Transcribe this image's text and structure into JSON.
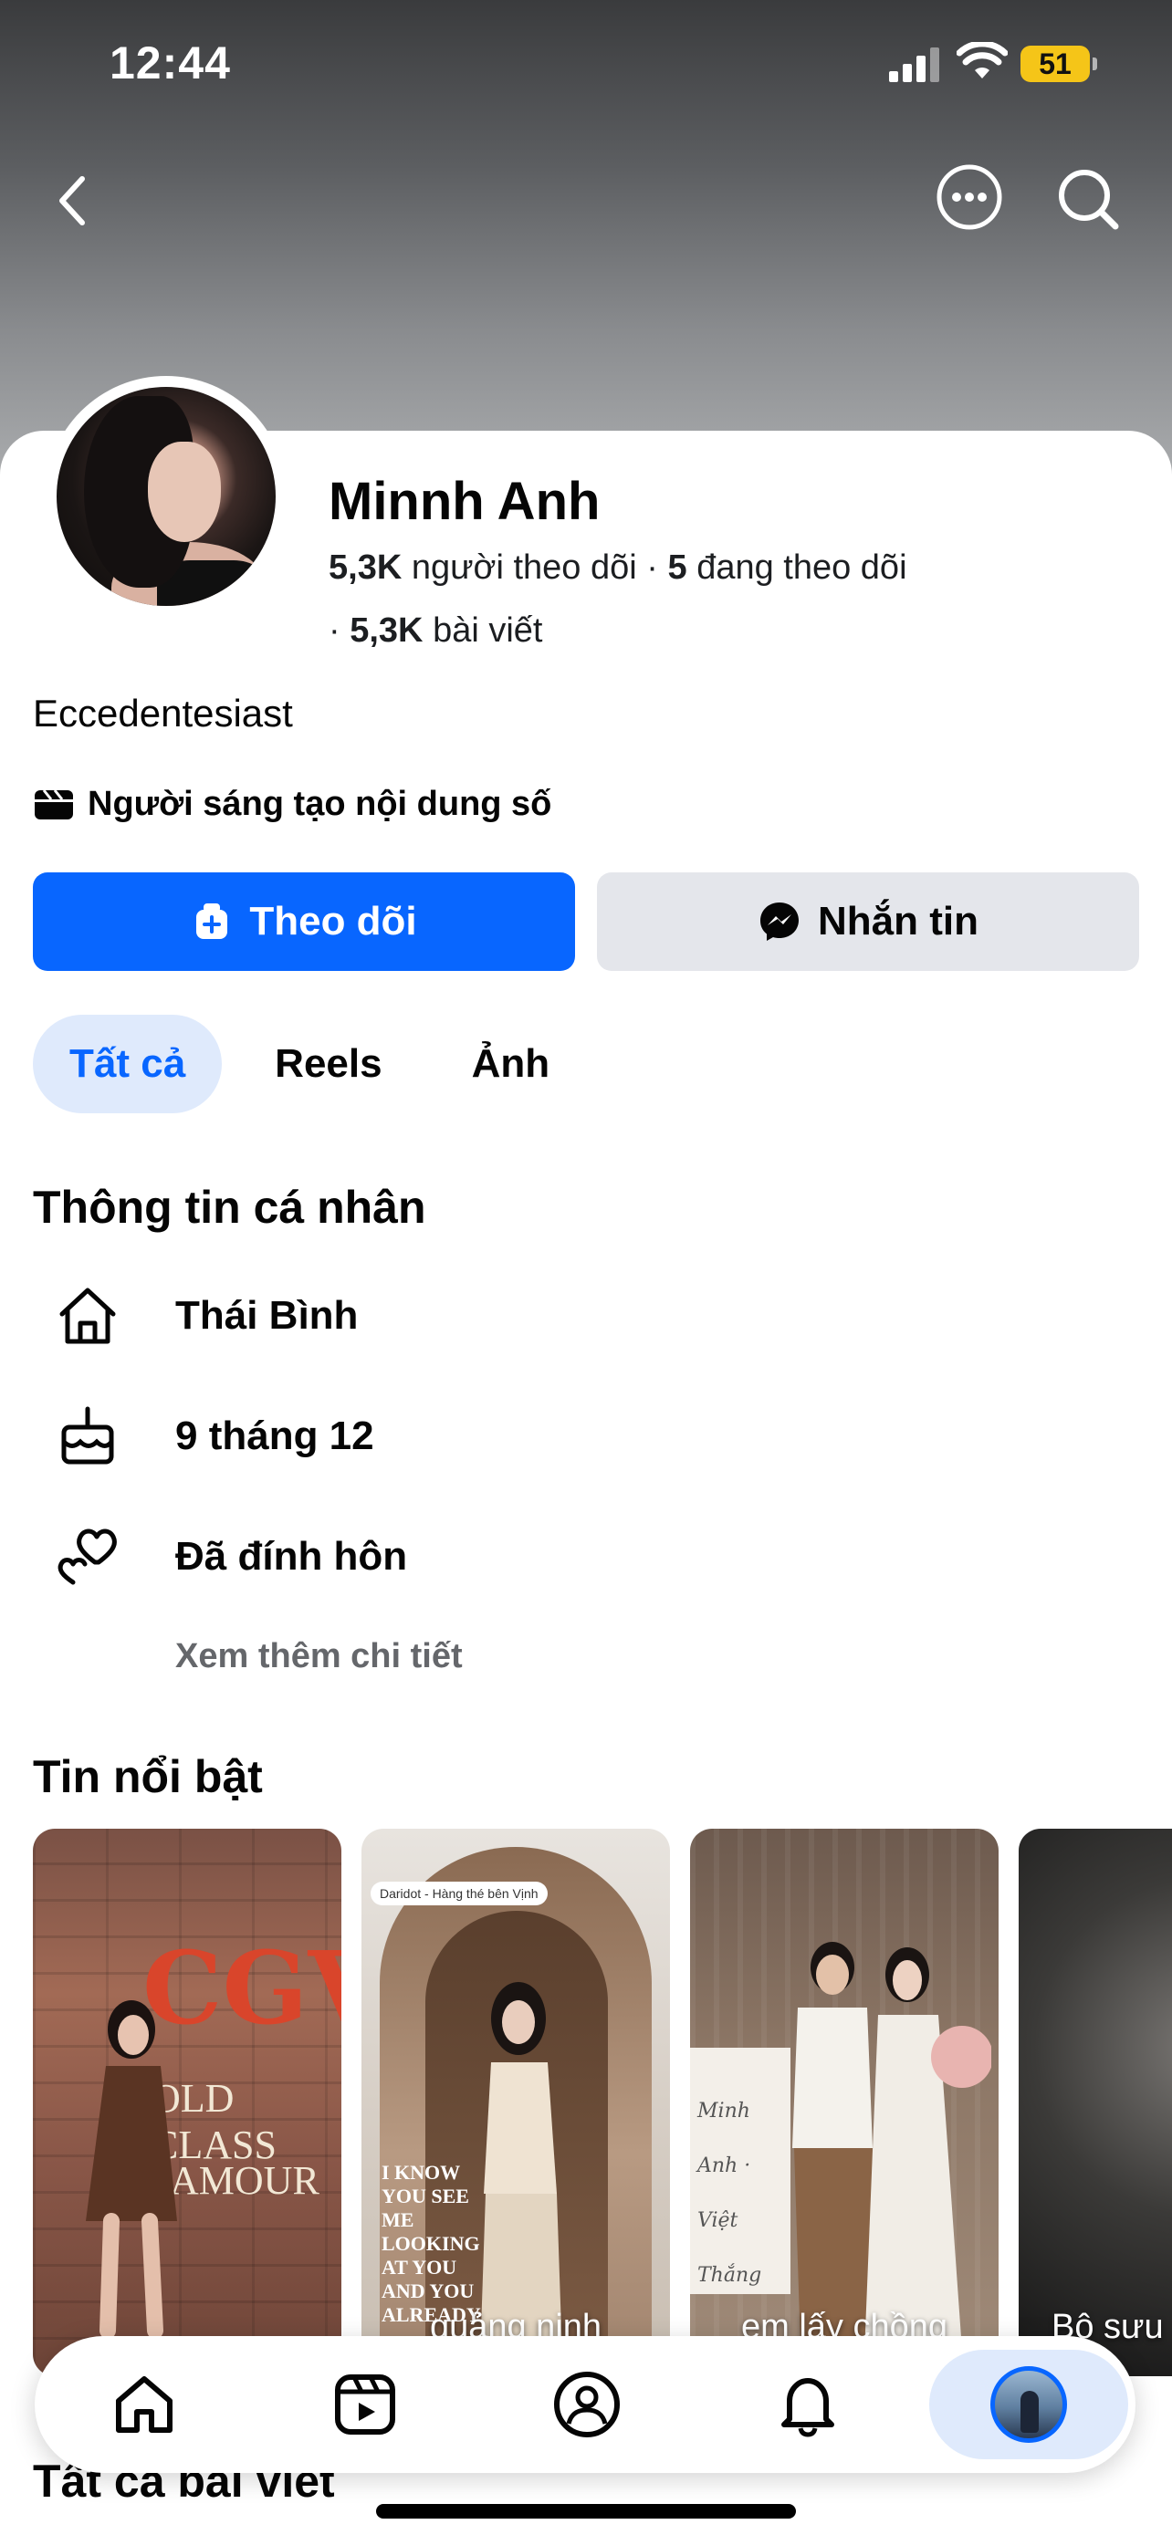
{
  "status_bar": {
    "time": "12:44",
    "battery": "51",
    "battery_color": "#f5c518"
  },
  "top_nav": {
    "back_icon": "chevron-left-icon",
    "more_icon": "more-horizontal-circle-icon",
    "search_icon": "search-icon"
  },
  "profile": {
    "name": "Minnh Anh",
    "followers_count": "5,3K",
    "followers_label": "người theo dõi",
    "following_count": "5",
    "following_label": "đang theo dõi",
    "posts_count": "5,3K",
    "posts_label": "bài viết",
    "bio": "Eccedentesiast",
    "category": "Người sáng tạo nội dung số"
  },
  "actions": {
    "follow_label": "Theo dõi",
    "message_label": "Nhắn tin",
    "follow_color": "#0866ff"
  },
  "tabs": [
    {
      "label": "Tất cả",
      "active": true
    },
    {
      "label": "Reels",
      "active": false
    },
    {
      "label": "Ảnh",
      "active": false
    }
  ],
  "personal_info": {
    "title": "Thông tin cá nhân",
    "items": [
      {
        "icon": "home-icon",
        "text": "Thái Bình"
      },
      {
        "icon": "birthday-cake-icon",
        "text": "9 tháng 12"
      },
      {
        "icon": "hearts-icon",
        "text": "Đã đính hôn"
      }
    ],
    "see_more": "Xem thêm chi tiết"
  },
  "highlights": {
    "title": "Tin nổi bật",
    "items": [
      {
        "label": "",
        "sign_text_1": "CGV",
        "sign_text_2": "OLD CLASS",
        "sign_text_3": "AMOUR"
      },
      {
        "label": "quảng ninh",
        "overlay_text": "I KNOW YOU SEE ME LOOKING AT YOU AND YOU ALREADY",
        "pin_text": "Daridot - Hàng thé bên Vịnh"
      },
      {
        "label": "em lấy chồng",
        "board_text": "Minh Anh · Việt Thắng"
      },
      {
        "label": "Bộ sưu"
      }
    ]
  },
  "all_posts_title": "Tất cả bài viết",
  "bottom_nav": [
    {
      "icon": "home-icon",
      "active": false
    },
    {
      "icon": "reels-icon",
      "active": false
    },
    {
      "icon": "friends-icon",
      "active": false
    },
    {
      "icon": "bell-icon",
      "active": false
    },
    {
      "icon": "profile-avatar-icon",
      "active": true
    }
  ]
}
